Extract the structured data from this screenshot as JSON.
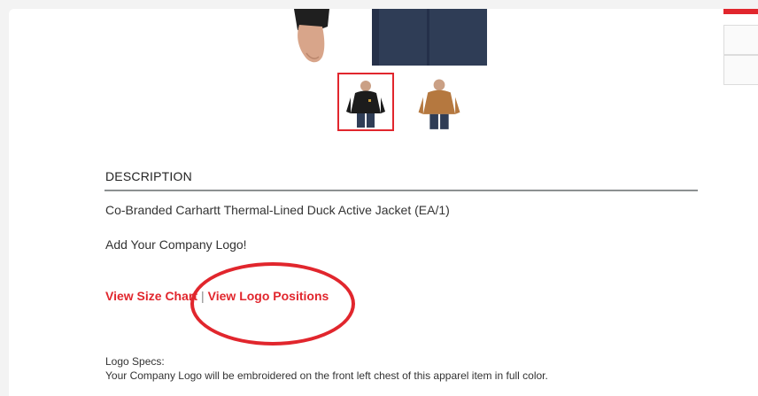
{
  "product": {
    "thumbnails": [
      {
        "name": "black-jacket",
        "selected": true
      },
      {
        "name": "brown-jacket",
        "selected": false
      }
    ]
  },
  "description": {
    "title": "DESCRIPTION",
    "line": "Co-Branded Carhartt Thermal-Lined Duck Active Jacket (EA/1)",
    "add_logo": "Add Your Company Logo!",
    "size_chart_link": "View Size Chart",
    "separator": "|",
    "logo_positions_link": "View Logo Positions",
    "specs_label": "Logo Specs:",
    "specs_text": "Your Company Logo will be embroidered on the front left chest of this apparel item in full color."
  },
  "colors": {
    "accent": "#e1262d",
    "rule": "#8c9091"
  }
}
